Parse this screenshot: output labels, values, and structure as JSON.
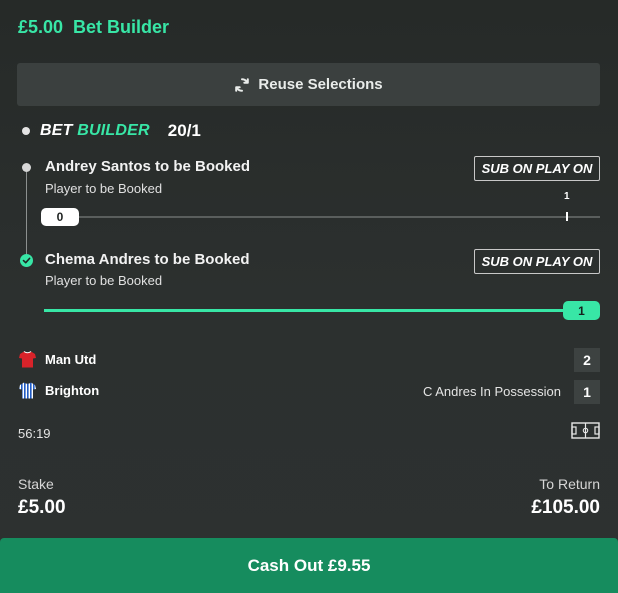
{
  "header": {
    "stake": "£5.00",
    "title": "Bet Builder"
  },
  "reuse_button": {
    "label": "Reuse Selections",
    "icon": "refresh-icon"
  },
  "bet_builder": {
    "logo_part1": "BET",
    "logo_part2": "BUILDER",
    "odds": "20/1"
  },
  "selections": [
    {
      "title": "Andrey Santos to be Booked",
      "market": "Player to be Booked",
      "sub_button": "SUB ON PLAY ON",
      "current": "0",
      "target": "1",
      "progress": 0,
      "status": "pending"
    },
    {
      "title": "Chema Andres to be Booked",
      "market": "Player to be Booked",
      "sub_button": "SUB ON PLAY ON",
      "current": "1",
      "progress": 1,
      "status": "won"
    }
  ],
  "match": {
    "home": {
      "name": "Man Utd",
      "score": "2",
      "icon": "red-shirt-icon"
    },
    "away": {
      "name": "Brighton",
      "score": "1",
      "icon": "blue-striped-shirt-icon"
    },
    "possession_text": "C Andres In Possession",
    "clock": "56:19"
  },
  "stake": {
    "label": "Stake",
    "value": "£5.00"
  },
  "to_return": {
    "label": "To Return",
    "value": "£105.00"
  },
  "cash_out": {
    "label": "Cash Out",
    "amount": "£9.55"
  },
  "colors": {
    "accent": "#38e6a6",
    "cashout_bg": "#168c5e",
    "background": "#2b2f2e"
  }
}
